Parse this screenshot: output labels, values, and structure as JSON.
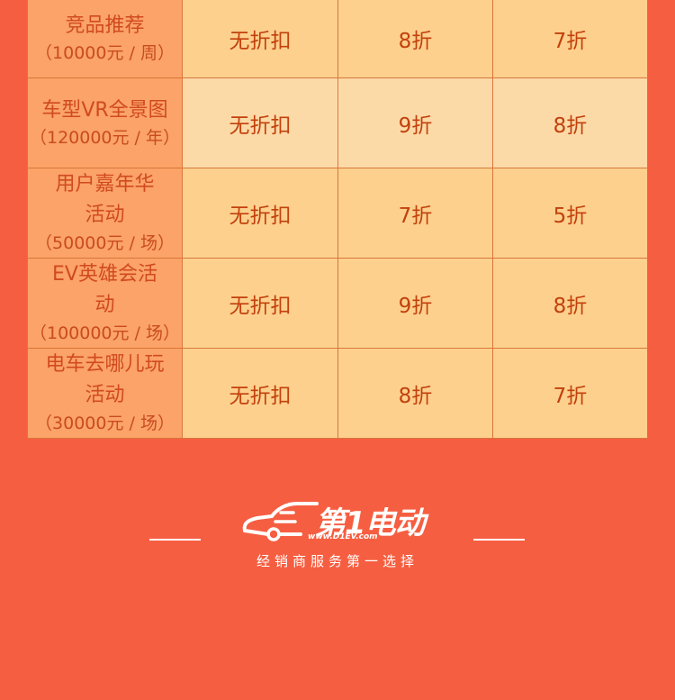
{
  "rows": [
    {
      "name": "竞品推荐",
      "price": "（10000元 / 周）",
      "col1": "无折扣",
      "col2": "8折",
      "col3": "7折"
    },
    {
      "name": "车型VR全景图",
      "price": "（120000元 / 年）",
      "col1": "无折扣",
      "col2": "9折",
      "col3": "8折"
    },
    {
      "name": "用户嘉年华活动",
      "price": "（50000元 / 场）",
      "col1": "无折扣",
      "col2": "7折",
      "col3": "5折"
    },
    {
      "name": "EV英雄会活动",
      "price": "（100000元 / 场）",
      "col1": "无折扣",
      "col2": "9折",
      "col3": "8折"
    },
    {
      "name": "电车去哪儿玩活动",
      "price": "（30000元 / 场）",
      "col1": "无折扣",
      "col2": "8折",
      "col3": "7折"
    }
  ],
  "footer": {
    "brand": "第1电动",
    "url": "www.D1EV.com",
    "slogan": "经销商服务第一选择"
  },
  "colors": {
    "background": "#f65e41",
    "name_cell": "#fba368",
    "cell": "#fdd08e",
    "cell_alt": "#fcdaa8",
    "text": "#c2410c"
  }
}
